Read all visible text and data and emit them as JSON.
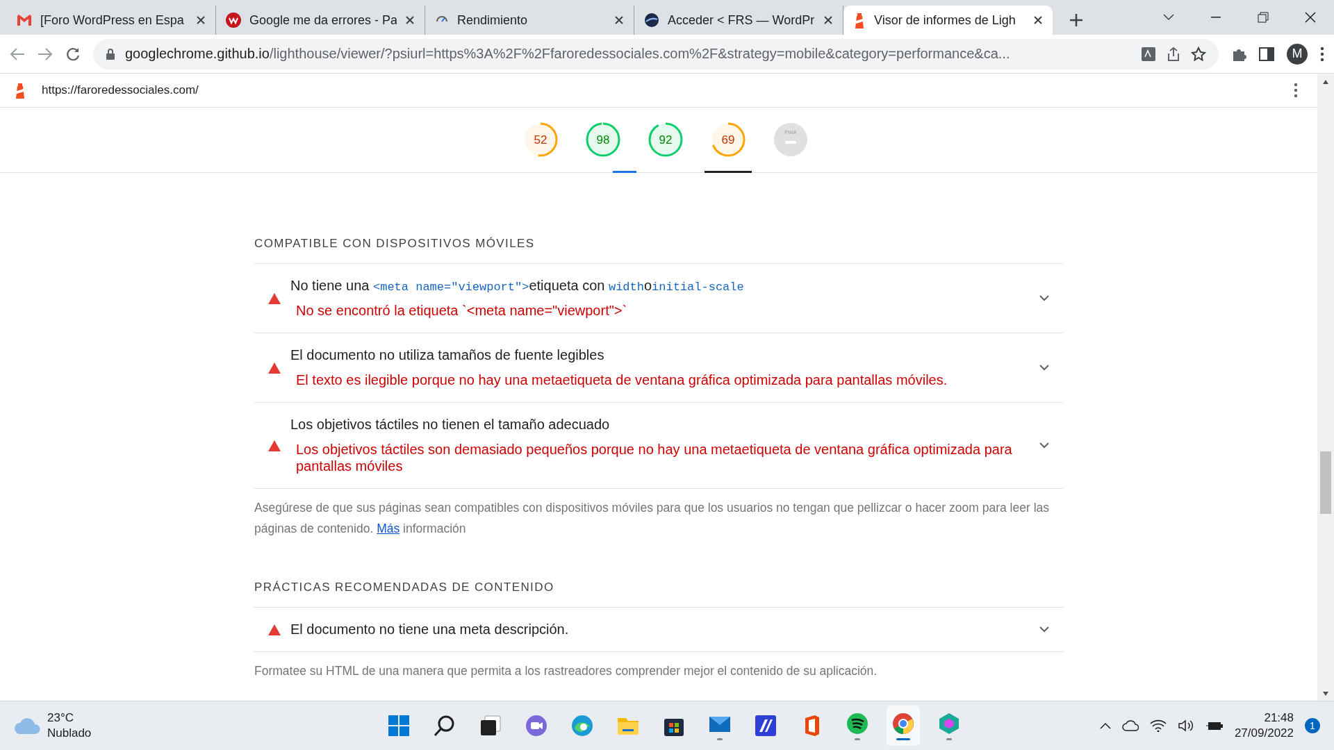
{
  "browser": {
    "tabs": [
      {
        "title": "[Foro WordPress en Espa",
        "kind": "mail",
        "selected": false
      },
      {
        "title": "Google me da errores - Pa",
        "kind": "wp",
        "selected": false
      },
      {
        "title": "Rendimiento",
        "kind": "perf",
        "selected": false
      },
      {
        "title": "Acceder < FRS — WordPr",
        "kind": "globe",
        "selected": false
      },
      {
        "title": "Visor de informes de Ligh",
        "kind": "lighthouse",
        "selected": true
      }
    ],
    "address_host": "googlechrome.github.io",
    "address_path": "/lighthouse/viewer/?psiurl=https%3A%2F%2Ffaroredessociales.com%2F&strategy=mobile&category=performance&ca...",
    "avatar": "M"
  },
  "report": {
    "url": "https://faroredessociales.com/",
    "gauges": [
      {
        "kind": "score",
        "value": "52",
        "selected": false
      },
      {
        "kind": "score",
        "value": "98",
        "selected": false
      },
      {
        "kind": "score",
        "value": "92",
        "selected": false
      },
      {
        "kind": "score",
        "value": "69",
        "selected": true
      },
      {
        "kind": "pwa",
        "value": "PWA",
        "selected": false
      }
    ],
    "sections": [
      {
        "heading": "COMPATIBLE CON DISPOSITIVOS MÓVILES",
        "audits": [
          {
            "title": [
              {
                "text": "No tiene una ",
                "code": false
              },
              {
                "text": "<meta name=\"viewport\">",
                "code": true
              },
              {
                "text": "etiqueta con ",
                "code": false
              },
              {
                "text": "width",
                "code": true
              },
              {
                "text": "o",
                "code": false
              },
              {
                "text": "initial-scale",
                "code": true
              }
            ],
            "detail": "No se encontró la etiqueta `<meta name=\"viewport\">`"
          },
          {
            "title": [
              {
                "text": "El documento no utiliza tamaños de fuente legibles",
                "code": false
              }
            ],
            "detail": "El texto es ilegible porque no hay una metaetiqueta de ventana gráfica optimizada para pantallas móviles."
          },
          {
            "title": [
              {
                "text": "Los objetivos táctiles no tienen el tamaño adecuado",
                "code": false
              }
            ],
            "detail": "Los objetivos táctiles son demasiado pequeños porque no hay una metaetiqueta de ventana gráfica optimizada para pantallas móviles"
          }
        ],
        "description": "Asegúrese de que sus páginas sean compatibles con dispositivos móviles para que los usuarios no tengan que pellizcar o hacer zoom para leer las páginas de contenido.",
        "link": "Más",
        "after_link": "información"
      },
      {
        "heading": "PRÁCTICAS RECOMENDADAS DE CONTENIDO",
        "audits": [
          {
            "title": [
              {
                "text": "El documento no tiene una meta descripción.",
                "code": false
              }
            ]
          }
        ],
        "description": "Formatee su HTML de una manera que permita a los rastreadores comprender mejor el contenido de su aplicación."
      }
    ]
  },
  "taskbar": {
    "weather": {
      "temp": "23°C",
      "text": "Nublado"
    },
    "apps": [
      {
        "kind": "start",
        "running": false,
        "active": false
      },
      {
        "kind": "search",
        "running": false,
        "active": false
      },
      {
        "kind": "taskview",
        "running": false,
        "active": false
      },
      {
        "kind": "chat",
        "running": false,
        "active": false
      },
      {
        "kind": "edge",
        "running": false,
        "active": false
      },
      {
        "kind": "folder",
        "running": false,
        "active": false
      },
      {
        "kind": "store",
        "running": false,
        "active": false
      },
      {
        "kind": "mail",
        "running": true,
        "active": false
      },
      {
        "kind": "editor",
        "running": false,
        "active": false
      },
      {
        "kind": "office",
        "running": false,
        "active": false
      },
      {
        "kind": "music",
        "running": true,
        "active": false
      },
      {
        "kind": "chrome",
        "running": true,
        "active": true
      },
      {
        "kind": "shield",
        "running": true,
        "active": false
      }
    ],
    "time": "21:48",
    "date": "27/09/2022",
    "notifications": "1"
  }
}
